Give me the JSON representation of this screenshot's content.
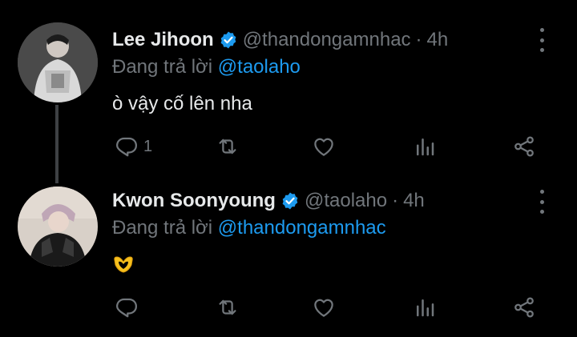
{
  "colors": {
    "background": "#000000",
    "text": "#e7e9ea",
    "muted": "#71767b",
    "link": "#1d9bf0",
    "verified": "#1d9bf0",
    "thread_line": "#3e4144"
  },
  "tweets": [
    {
      "name": "Lee Jihoon",
      "verified": true,
      "handle": "@thandongamnhac",
      "separator": "·",
      "time": "4h",
      "reply_prefix": "Đang trả lời",
      "reply_to": "@taolaho",
      "text": "ò vậy cố lên nha",
      "reply_count": "1",
      "icons": [
        "reply-icon",
        "retweet-icon",
        "like-icon",
        "stats-icon",
        "share-icon",
        "more-icon"
      ]
    },
    {
      "name": "Kwon Soonyoung",
      "verified": true,
      "handle": "@taolaho",
      "separator": "·",
      "time": "4h",
      "reply_prefix": "Đang trả lời",
      "reply_to": "@thandongamnhac",
      "text": "",
      "emoji": "heart-hands-emoji",
      "reply_count": "",
      "icons": [
        "reply-icon",
        "retweet-icon",
        "like-icon",
        "stats-icon",
        "share-icon",
        "more-icon"
      ]
    }
  ]
}
